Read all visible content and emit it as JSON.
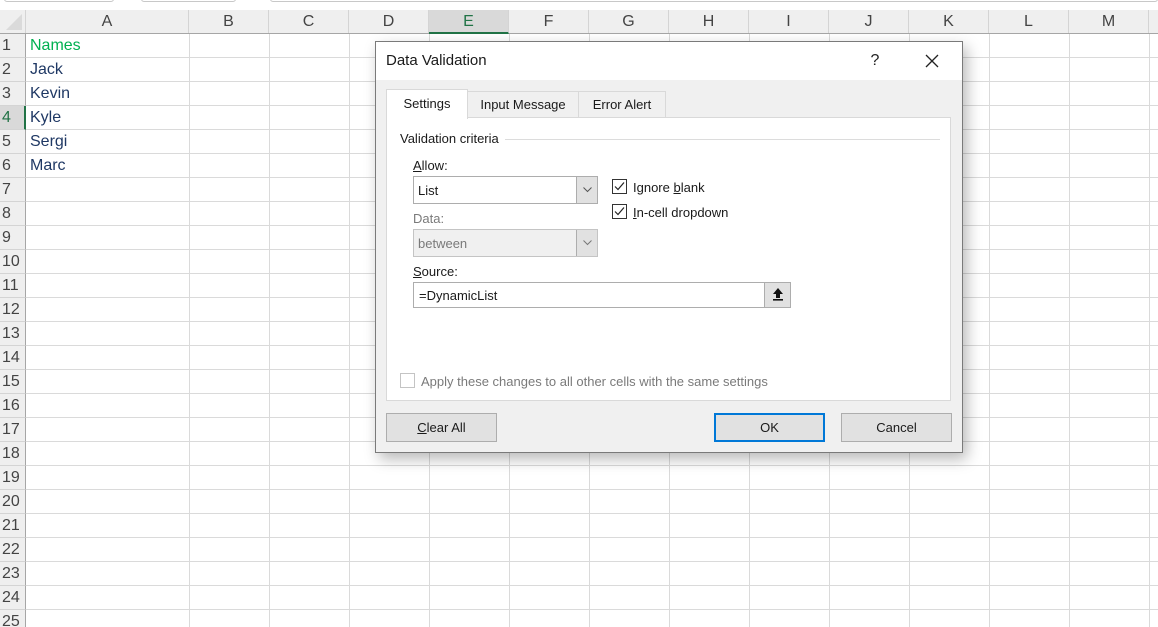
{
  "spreadsheet": {
    "columns": [
      "A",
      "B",
      "C",
      "D",
      "E",
      "F",
      "G",
      "H",
      "I",
      "J",
      "K",
      "L",
      "M"
    ],
    "selected_column": "E",
    "rows": [
      "1",
      "2",
      "3",
      "4",
      "5",
      "6",
      "7",
      "8",
      "9",
      "10",
      "11",
      "12",
      "13",
      "14",
      "15",
      "16",
      "17",
      "18",
      "19",
      "20",
      "21",
      "22",
      "23",
      "24",
      "25"
    ],
    "selected_row": "4",
    "cells": {
      "A1": "Names",
      "A2": "Jack",
      "A3": "Kevin",
      "A4": "Kyle",
      "A5": "Sergi",
      "A6": "Marc"
    },
    "colors": {
      "header_text": "#00b050",
      "cell_text": "#1f3864",
      "selection_accent": "#217346"
    }
  },
  "dialog": {
    "title": "Data Validation",
    "help_label": "?",
    "close_icon": "close-icon",
    "tabs": [
      {
        "label": "Settings",
        "active": true
      },
      {
        "label": "Input Message",
        "active": false
      },
      {
        "label": "Error Alert",
        "active": false
      }
    ],
    "settings": {
      "group_label": "Validation criteria",
      "allow_label": "Allow:",
      "allow_label_accel": "A",
      "allow_label_rest": "llow:",
      "allow_value": "List",
      "data_label": "Data:",
      "data_value": "between",
      "data_enabled": false,
      "ignore_blank_pre": "Ignore ",
      "ignore_blank_accel": "b",
      "ignore_blank_post": "lank",
      "ignore_blank_checked": true,
      "incell_accel": "I",
      "incell_post": "n-cell dropdown",
      "incell_checked": true,
      "source_accel": "S",
      "source_rest": "ource:",
      "source_value": "=DynamicList",
      "source_ref_icon": "collapse-dialog-icon",
      "apply_all_label": "Apply these changes to all other cells with the same settings",
      "apply_all_checked": false,
      "apply_all_enabled": false
    },
    "buttons": {
      "clear_all_accel": "C",
      "clear_all_rest": "lear All",
      "ok": "OK",
      "cancel": "Cancel"
    },
    "accent_color": "#0078d7"
  }
}
